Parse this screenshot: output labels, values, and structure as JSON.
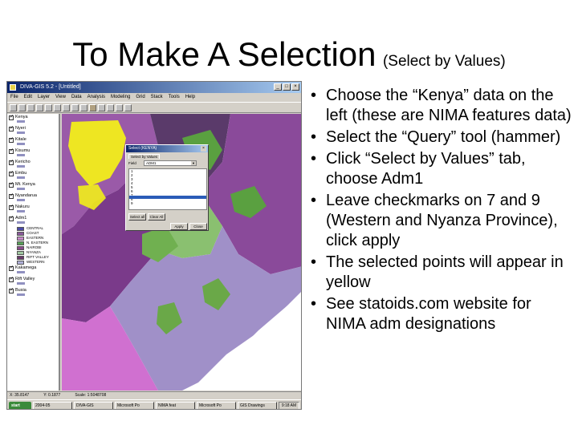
{
  "slide": {
    "title": "To Make A Selection",
    "subtitle": "(Select by Values)"
  },
  "bullets": [
    "Choose the “Kenya” data on the left (these are NIMA features data)",
    "Select the “Query” tool (hammer)",
    "Click “Select by Values” tab, choose Adm1",
    "Leave checkmarks on 7 and 9 (Western and Nyanza Province), click apply",
    "The selected points will appear in yellow",
    "See statoids.com website for NIMA adm designations"
  ],
  "app": {
    "title": "DIVA-GIS 5.2 - [Untitled]",
    "menu": [
      "File",
      "Edit",
      "Layer",
      "View",
      "Data",
      "Analysis",
      "Modeling",
      "Grid",
      "Stack",
      "Tools",
      "Help"
    ],
    "toc": {
      "layers": [
        "Kenya",
        "Nyeri",
        "Kitale",
        "Kisumu",
        "Kericho",
        "Embu",
        "Mt. Kenya",
        "Nyandarua",
        "Nakuru",
        "Adm1",
        "Kakamega",
        "Rift Valley",
        "Busia"
      ],
      "legend": [
        {
          "label": "CENTRAL",
          "color": "#4a4aa8"
        },
        {
          "label": "COAST",
          "color": "#8a5a9a"
        },
        {
          "label": "EASTERN",
          "color": "#c88ac8"
        },
        {
          "label": "N. EASTERN",
          "color": "#5aa05a"
        },
        {
          "label": "NAIROBI",
          "color": "#8a4a8a"
        },
        {
          "label": "NYANZA",
          "color": "#a0c8a0"
        },
        {
          "label": "RIFT VALLEY",
          "color": "#6a3a6a"
        },
        {
          "label": "WESTERN",
          "color": "#b0b0d8"
        }
      ]
    },
    "dialog": {
      "title": "Select (KENYA)",
      "tab": "Select by Values",
      "field_label": "Field",
      "field_value": "ADM1",
      "items": [
        "1",
        "2",
        "3",
        "4",
        "5",
        "6",
        "7",
        "8",
        "9"
      ],
      "btn_select_all": "Select all",
      "btn_clear_all": "Clear All",
      "btn_apply": "Apply",
      "btn_close": "Close"
    },
    "status": [
      "X: 35.8147",
      "Y: 0.1877",
      "Scale: 1:5048708"
    ],
    "taskbar": {
      "start": "start",
      "tasks": [
        "2004-05",
        "DIVA-GIS",
        "Microsoft Po",
        "NIMA feat",
        "Microsoft Po",
        "GIS Drawings"
      ],
      "clock": "9:18 AM"
    }
  }
}
